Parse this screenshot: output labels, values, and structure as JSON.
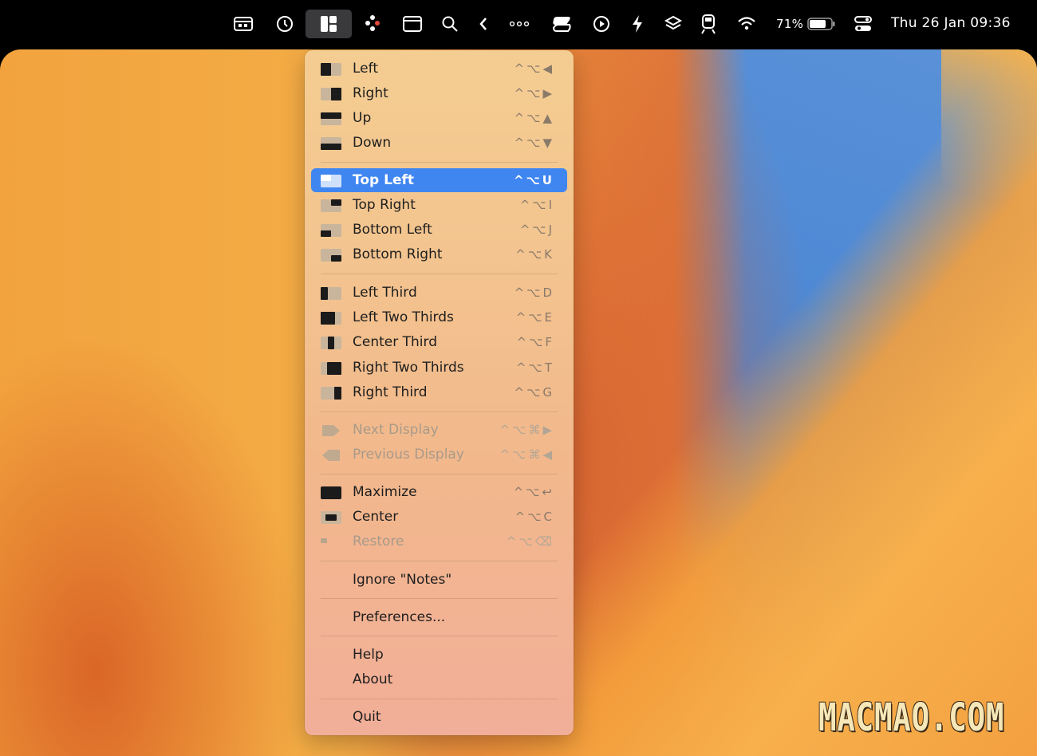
{
  "menubar": {
    "icons": [
      "calendar-window-icon",
      "history-icon",
      "rectangle-app-icon",
      "dots-grid-icon",
      "window-icon",
      "search-icon",
      "chevron-left-icon",
      "more-icon",
      "shortcut-icon",
      "play-icon",
      "bolt-icon",
      "layers-icon",
      "train-icon",
      "wifi-icon",
      "battery-icon",
      "control-center-icon"
    ],
    "battery_percent": "71%",
    "datetime": "Thu 26 Jan  09:36"
  },
  "menu": {
    "items": [
      {
        "label": "Left",
        "shortcut": "^⌥◀",
        "icon": "left-half-icon"
      },
      {
        "label": "Right",
        "shortcut": "^⌥▶",
        "icon": "right-half-icon"
      },
      {
        "label": "Up",
        "shortcut": "^⌥▲",
        "icon": "top-half-icon"
      },
      {
        "label": "Down",
        "shortcut": "^⌥▼",
        "icon": "bottom-half-icon"
      },
      {
        "label": "Top Left",
        "shortcut": "^⌥U",
        "icon": "top-left-icon"
      },
      {
        "label": "Top Right",
        "shortcut": "^⌥I",
        "icon": "top-right-icon"
      },
      {
        "label": "Bottom Left",
        "shortcut": "^⌥J",
        "icon": "bottom-left-icon"
      },
      {
        "label": "Bottom Right",
        "shortcut": "^⌥K",
        "icon": "bottom-right-icon"
      },
      {
        "label": "Left Third",
        "shortcut": "^⌥D",
        "icon": "left-third-icon"
      },
      {
        "label": "Left Two Thirds",
        "shortcut": "^⌥E",
        "icon": "left-two-thirds-icon"
      },
      {
        "label": "Center Third",
        "shortcut": "^⌥F",
        "icon": "center-third-icon"
      },
      {
        "label": "Right Two Thirds",
        "shortcut": "^⌥T",
        "icon": "right-two-thirds-icon"
      },
      {
        "label": "Right Third",
        "shortcut": "^⌥G",
        "icon": "right-third-icon"
      },
      {
        "label": "Next Display",
        "shortcut": "^⌥⌘▶",
        "icon": "next-display-icon"
      },
      {
        "label": "Previous Display",
        "shortcut": "^⌥⌘◀",
        "icon": "previous-display-icon"
      },
      {
        "label": "Maximize",
        "shortcut": "^⌥↩",
        "icon": "maximize-icon"
      },
      {
        "label": "Center",
        "shortcut": "^⌥C",
        "icon": "center-icon"
      },
      {
        "label": "Restore",
        "shortcut": "^⌥⌫",
        "icon": "restore-icon"
      },
      {
        "label": "Ignore \"Notes\""
      },
      {
        "label": "Preferences..."
      },
      {
        "label": "Help"
      },
      {
        "label": "About"
      },
      {
        "label": "Quit"
      }
    ]
  },
  "watermark": "MACMAO.COM",
  "colors": {
    "selection": "#3f86f0",
    "menubar": "#000000"
  }
}
